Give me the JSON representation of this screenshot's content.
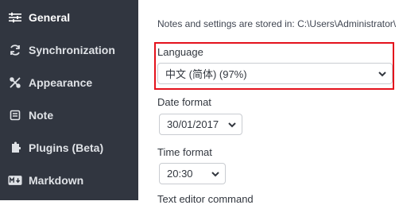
{
  "sidebar": {
    "items": [
      {
        "label": "General",
        "icon": "sliders-icon"
      },
      {
        "label": "Synchronization",
        "icon": "sync-icon"
      },
      {
        "label": "Appearance",
        "icon": "paint-tools-icon"
      },
      {
        "label": "Note",
        "icon": "note-icon"
      },
      {
        "label": "Plugins (Beta)",
        "icon": "puzzle-icon"
      },
      {
        "label": "Markdown",
        "icon": "markdown-icon"
      }
    ]
  },
  "main": {
    "storage_note": "Notes and settings are stored in: C:\\Users\\Administrator\\",
    "language": {
      "label": "Language",
      "value": "中文 (简体) (97%)"
    },
    "date_format": {
      "label": "Date format",
      "value": "30/01/2017"
    },
    "time_format": {
      "label": "Time format",
      "value": "20:30"
    },
    "next_label_partial": "Text editor command"
  },
  "colors": {
    "sidebar_bg": "#313640",
    "highlight_border": "#e4121c"
  }
}
